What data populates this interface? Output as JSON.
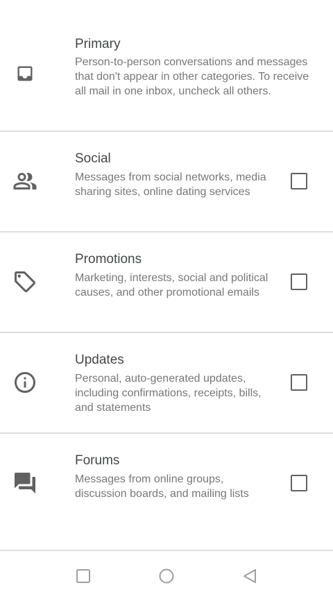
{
  "categories": [
    {
      "title": "Primary",
      "description": "Person-to-person conversations and messages that don't appear in other categories. To receive all mail in one inbox, uncheck all others.",
      "icon": "inbox-icon",
      "has_checkbox": false
    },
    {
      "title": "Social",
      "description": "Messages from social networks, media sharing sites, online dating services",
      "icon": "people-icon",
      "checked": false
    },
    {
      "title": "Promotions",
      "description": "Marketing, interests, social and political causes, and other promotional emails",
      "icon": "tag-icon",
      "checked": false
    },
    {
      "title": "Updates",
      "description": "Personal, auto-generated updates, including confirmations, receipts, bills, and statements",
      "icon": "info-icon",
      "checked": false
    },
    {
      "title": "Forums",
      "description": "Messages from online groups, discussion boards, and mailing lists",
      "icon": "forum-icon",
      "checked": false
    }
  ],
  "navigation_bar": {
    "buttons": [
      "recents-button",
      "home-button",
      "back-button"
    ]
  },
  "colors": {
    "text_title": "#444746",
    "text_body": "#777777",
    "icon": "#616161",
    "divider": "#dcdcdc",
    "background": "#ffffff"
  }
}
